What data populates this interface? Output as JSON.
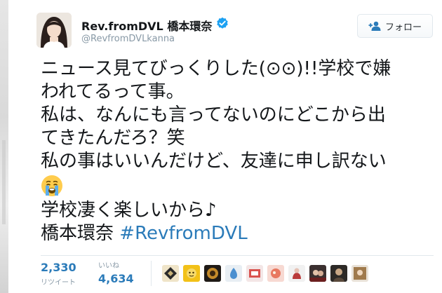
{
  "tweet": {
    "display_name": "Rev.fromDVL 橋本環奈",
    "username": "@RevfromDVLkanna",
    "follow_label": "フォロー",
    "lines": [
      "ニュース見てびっくりした(⊙⊙)!!学校で嫌",
      "われてるって事。",
      "私は、なんにも言ってないのにどこから出",
      "てきたんだろ？笑",
      "私の事はいいんだけど、友達に申し訳ない",
      "学校凄く楽しいから♪"
    ],
    "signature_name": "橋本環奈",
    "hashtag": "#RevfromDVL",
    "emoji": "crying-face"
  },
  "stats": {
    "retweets": "2,330",
    "retweets_label": "リツイート",
    "likes": "4,634",
    "likes_label": "いいね"
  },
  "colors": {
    "link": "#2b7bb9",
    "text": "#14171a",
    "muted": "#8899a6",
    "verified": "#1da1f2",
    "border": "#e1e8ed"
  },
  "liker_avatars": [
    "avatar-1",
    "avatar-2",
    "avatar-3",
    "avatar-4",
    "avatar-5",
    "avatar-6",
    "avatar-7",
    "avatar-8",
    "avatar-9",
    "avatar-10"
  ]
}
